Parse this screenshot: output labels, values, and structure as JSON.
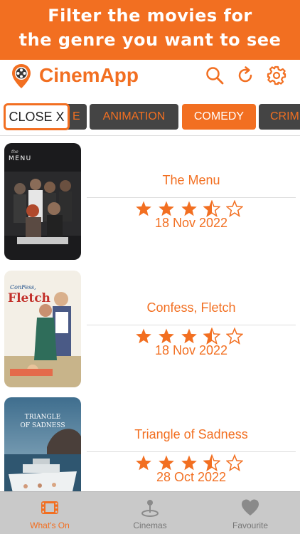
{
  "promo": {
    "line1": "Filter the movies for",
    "line2": "the genre you want to see"
  },
  "app": {
    "title": "CinemApp",
    "accent": "#f26f21"
  },
  "actions": {
    "search_icon": "search-icon",
    "refresh_icon": "refresh-icon",
    "settings_icon": "gear-icon"
  },
  "genres": {
    "close_label": "CLOSE X",
    "partial_label": "E",
    "animation_label": "ANIMATION",
    "comedy_label": "COMEDY",
    "crime_label": "CRIM",
    "selected": "COMEDY"
  },
  "movies": [
    {
      "title": "The Menu",
      "date": "18 Nov 2022",
      "rating": 3.5,
      "max_rating": 5,
      "poster_text": "the MENU"
    },
    {
      "title": "Confess, Fletch",
      "date": "18 Nov 2022",
      "rating": 3.5,
      "max_rating": 5,
      "poster_text": "Confess, Fletch"
    },
    {
      "title": "Triangle of Sadness",
      "date": "28 Oct 2022",
      "rating": 3.5,
      "max_rating": 5,
      "poster_text": "TRIANGLE OF SADNESS"
    }
  ],
  "tabs": [
    {
      "label": "What's On",
      "icon": "film-icon",
      "active": true
    },
    {
      "label": "Cinemas",
      "icon": "map-pin-icon",
      "active": false
    },
    {
      "label": "Favourite",
      "icon": "heart-icon",
      "active": false
    }
  ]
}
